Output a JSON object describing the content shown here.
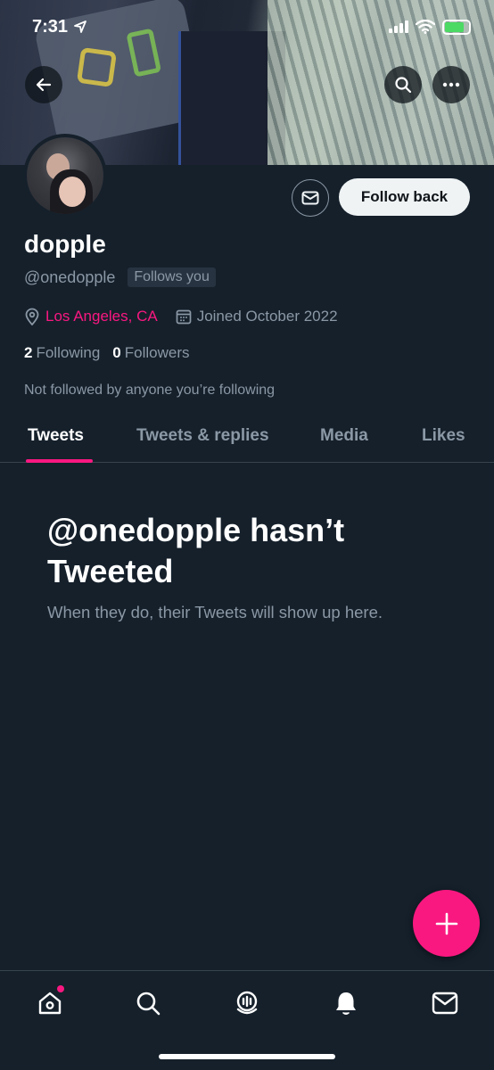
{
  "status_bar": {
    "time": "7:31"
  },
  "profile": {
    "display_name": "dopple",
    "handle": "@onedopple",
    "follows_you_badge": "Follows you",
    "location": "Los Angeles, CA",
    "joined": "Joined October 2022",
    "following_count": "2",
    "following_label": "Following",
    "followers_count": "0",
    "followers_label": "Followers",
    "mutuals_note": "Not followed by anyone you’re following"
  },
  "actions": {
    "follow_back_label": "Follow back"
  },
  "tabs": [
    {
      "label": "Tweets",
      "active": true
    },
    {
      "label": "Tweets & replies",
      "active": false
    },
    {
      "label": "Media",
      "active": false
    },
    {
      "label": "Likes",
      "active": false
    }
  ],
  "empty_state": {
    "title": "@onedopple hasn’t Tweeted",
    "subtitle": "When they do, their Tweets will show up here."
  },
  "bottom_nav": [
    "home-icon",
    "search-icon",
    "spaces-icon",
    "notifications-icon",
    "messages-icon"
  ],
  "colors": {
    "accent": "#f91880",
    "background": "#15202b",
    "muted": "#8b98a5"
  }
}
